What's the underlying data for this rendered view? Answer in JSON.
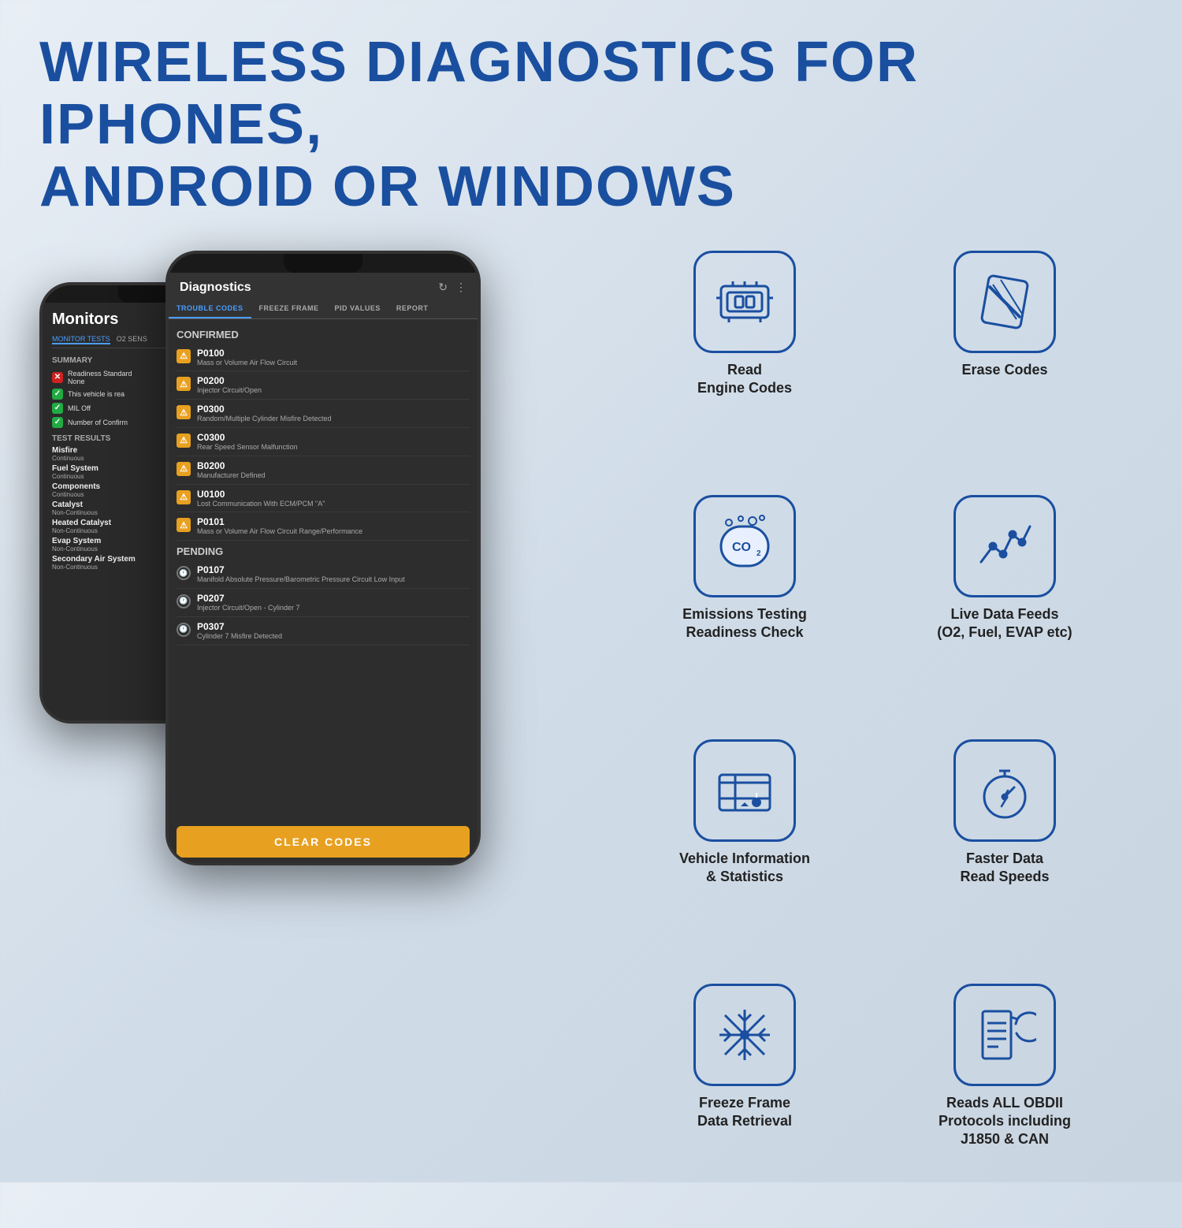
{
  "header": {
    "title": "WIRELESS  DIAGNOSTICS  FOR  IPHONES,\nANDROID OR WINDOWS"
  },
  "phone_back": {
    "title": "Monitors",
    "tabs": [
      "MONITOR TESTS",
      "O2 SENS"
    ],
    "summary_title": "SUMMARY",
    "summary_items": [
      {
        "icon": "✕",
        "type": "red",
        "text": "Readiness Standard\nNone"
      },
      {
        "icon": "✓",
        "type": "green",
        "text": "This vehicle is rea"
      },
      {
        "icon": "✓",
        "type": "green",
        "text": "MIL Off"
      },
      {
        "icon": "✓",
        "type": "green",
        "text": "Number of Confirm"
      }
    ],
    "test_results_title": "TEST RESULTS",
    "test_results": [
      {
        "name": "Misfire",
        "sub": "Continuous"
      },
      {
        "name": "Fuel System",
        "sub": "Continuous"
      },
      {
        "name": "Components",
        "sub": "Continuous"
      },
      {
        "name": "Catalyst",
        "sub": "Non-Continuous"
      },
      {
        "name": "Heated Catalyst",
        "sub": "Non-Continuous"
      },
      {
        "name": "Evap System",
        "sub": "Non-Continuous"
      },
      {
        "name": "Secondary Air System",
        "sub": "Non-Continuous"
      }
    ]
  },
  "phone_front": {
    "title": "Diagnostics",
    "tabs": [
      "TROUBLE CODES",
      "FREEZE FRAME",
      "PID VALUES",
      "REPORT"
    ],
    "active_tab": "TROUBLE CODES",
    "confirmed_label": "CONFIRMED",
    "confirmed_codes": [
      {
        "code": "P0100",
        "desc": "Mass or Volume Air Flow Circuit"
      },
      {
        "code": "P0200",
        "desc": "Injector Circuit/Open"
      },
      {
        "code": "P0300",
        "desc": "Random/Multiple Cylinder Misfire Detected"
      },
      {
        "code": "C0300",
        "desc": "Rear Speed Sensor Malfunction"
      },
      {
        "code": "B0200",
        "desc": "Manufacturer Defined"
      },
      {
        "code": "U0100",
        "desc": "Lost Communication With ECM/PCM \"A\""
      },
      {
        "code": "P0101",
        "desc": "Mass or Volume Air Flow Circuit Range/Performance"
      }
    ],
    "pending_label": "PENDING",
    "pending_codes": [
      {
        "code": "P0107",
        "desc": "Manifold Absolute Pressure/Barometric Pressure Circuit Low Input"
      },
      {
        "code": "P0207",
        "desc": "Injector Circuit/Open - Cylinder 7"
      },
      {
        "code": "P0307",
        "desc": "Cylinder 7 Misfire Detected"
      }
    ],
    "clear_button": "CLEAR CODES"
  },
  "features": [
    {
      "id": "read-engine-codes",
      "label": "Read\nEngine Codes",
      "icon": "engine"
    },
    {
      "id": "erase-codes",
      "label": "Erase Codes",
      "icon": "pencil"
    },
    {
      "id": "emissions-testing",
      "label": "Emissions Testing\nReadiness Check",
      "icon": "co2"
    },
    {
      "id": "live-data-feeds",
      "label": "Live Data Feeds\n(O2, Fuel, EVAP etc)",
      "icon": "chart"
    },
    {
      "id": "vehicle-information",
      "label": "Vehicle Information\n& Statistics",
      "icon": "vehicle-info"
    },
    {
      "id": "faster-data",
      "label": "Faster Data\nRead Speeds",
      "icon": "stopwatch"
    },
    {
      "id": "freeze-frame",
      "label": "Freeze Frame\nData Retrieval",
      "icon": "snowflake"
    },
    {
      "id": "reads-obdii",
      "label": "Reads ALL OBDII\nProtocols including\nJ1850 & CAN",
      "icon": "obdii"
    }
  ]
}
